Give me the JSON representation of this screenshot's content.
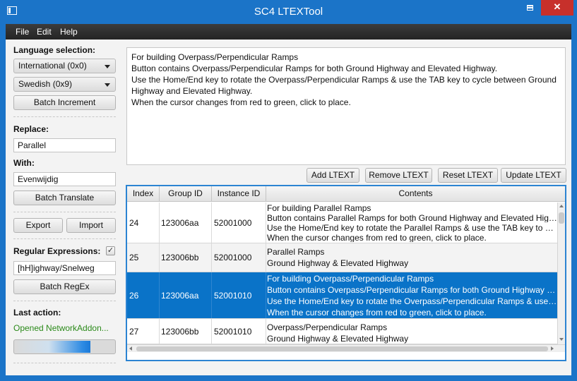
{
  "window": {
    "title": "SC4 LTEXTool"
  },
  "menu": [
    "File",
    "Edit",
    "Help"
  ],
  "left": {
    "language_label": "Language selection:",
    "language_primary": "International (0x0)",
    "language_secondary": "Swedish (0x9)",
    "batch_increment": "Batch Increment",
    "replace_label": "Replace:",
    "replace_value": "Parallel",
    "with_label": "With:",
    "with_value": "Evenwijdig",
    "batch_translate": "Batch Translate",
    "export": "Export",
    "import": "Import",
    "regex_label": "Regular Expressions:",
    "regex_checked": true,
    "regex_value": "[hH]ighway/Snelweg",
    "batch_regex": "Batch RegEx",
    "last_action_label": "Last action:",
    "last_action_value": "Opened NetworkAddon...",
    "progress": 0.75,
    "status_color": "#2b8a1a"
  },
  "editor": {
    "lines": [
      "For building Overpass/Perpendicular Ramps",
      "Button contains Overpass/Perpendicular Ramps for both Ground Highway and Elevated Highway.",
      "Use the Home/End key to rotate the Overpass/Perpendicular Ramps & use the TAB key to cycle between Ground",
      "Highway and Elevated Highway.",
      "When the cursor changes from red to green, click to place."
    ]
  },
  "toolbar": {
    "add": "Add LTEXT",
    "remove": "Remove LTEXT",
    "reset": "Reset LTEXT",
    "update": "Update LTEXT"
  },
  "table": {
    "headers": [
      "Index",
      "Group ID",
      "Instance ID",
      "Contents"
    ],
    "selected_color": "#0a73c8",
    "rows": [
      {
        "index": "24",
        "group": "123006aa",
        "instance": "52001000",
        "contents": [
          "For building Parallel Ramps",
          "Button contains Parallel Ramps for both Ground Highway and Elevated High...",
          "Use the Home/End key to rotate the Parallel Ramps & use the TAB key to cy...",
          "When the cursor changes from red to green, click to place."
        ]
      },
      {
        "index": "25",
        "group": "123006bb",
        "instance": "52001000",
        "contents": [
          "Parallel Ramps",
          "Ground Highway & Elevated Highway"
        ]
      },
      {
        "index": "26",
        "group": "123006aa",
        "instance": "52001010",
        "contents": [
          "For building Overpass/Perpendicular Ramps",
          "Button contains Overpass/Perpendicular Ramps for both Ground Highway a...",
          "Use the Home/End key to rotate the Overpass/Perpendicular Ramps & use t...",
          "When the cursor changes from red to green, click to place."
        ]
      },
      {
        "index": "27",
        "group": "123006bb",
        "instance": "52001010",
        "contents": [
          "Overpass/Perpendicular Ramps",
          "Ground Highway & Elevated Highway"
        ]
      }
    ]
  }
}
